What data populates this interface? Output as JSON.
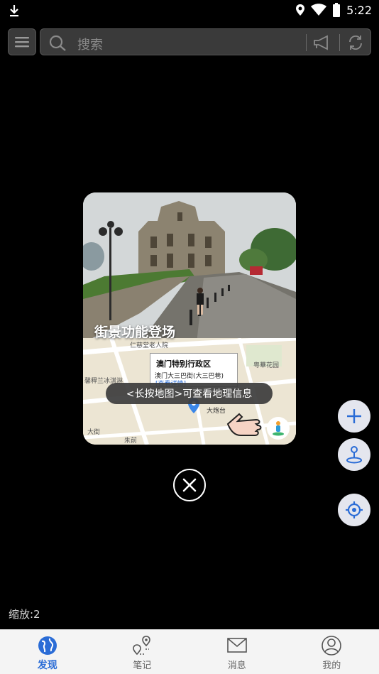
{
  "status_bar": {
    "time": "5:22"
  },
  "search": {
    "placeholder": "搜索"
  },
  "promo": {
    "title": "街景功能登场",
    "info_title": "澳门特别行政区",
    "info_address": "澳门大三巴街(大三巴巷)",
    "info_link": "[查看详情]",
    "map_labels": [
      "仁慈堂老人院",
      "粤華花园",
      "馨稈兰冰淇淋",
      "大炮台",
      "大街",
      "朱前"
    ]
  },
  "toast": "<长按地图>可查看地理信息",
  "zoom_label": "缩放:2",
  "bottom_nav": [
    {
      "label": "发现",
      "icon": "globe-icon",
      "active": true
    },
    {
      "label": "笔记",
      "icon": "route-pin-icon",
      "active": false
    },
    {
      "label": "消息",
      "icon": "envelope-icon",
      "active": false
    },
    {
      "label": "我的",
      "icon": "user-icon",
      "active": false
    }
  ],
  "colors": {
    "accent": "#2a6cd6",
    "fab_bg": "#e4e6ee",
    "fab_icon": "#2a6cd6"
  }
}
